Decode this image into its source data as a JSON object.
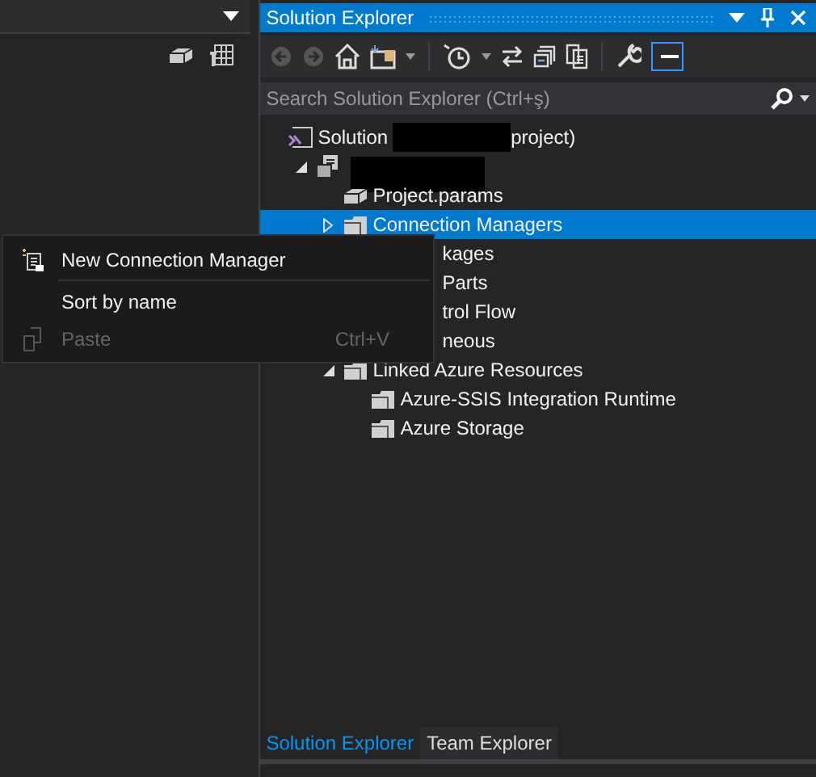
{
  "solution_explorer": {
    "title": "Solution Explorer",
    "search": {
      "placeholder": "Search Solution Explorer (Ctrl+ş)"
    },
    "tree": [
      {
        "kind": "solution",
        "label": "Solution",
        "redacted": true,
        "suffix": "project)",
        "children": [
          {
            "kind": "project",
            "redacted": true,
            "expanded": true,
            "children": [
              {
                "kind": "params",
                "label": "Project.params"
              },
              {
                "kind": "folder",
                "label": "Connection Managers",
                "expanded": false,
                "selected": true
              },
              {
                "kind": "partial",
                "label": "kages"
              },
              {
                "kind": "partial",
                "label": "Parts"
              },
              {
                "kind": "partial",
                "label": "trol Flow"
              },
              {
                "kind": "partial",
                "label": "neous"
              },
              {
                "kind": "folder",
                "label": "Linked Azure Resources",
                "expanded": true,
                "selected": false,
                "children": [
                  {
                    "kind": "folder",
                    "label": "Azure-SSIS Integration Runtime"
                  },
                  {
                    "kind": "folder",
                    "label": "Azure Storage"
                  }
                ]
              }
            ]
          }
        ]
      }
    ],
    "tabs": [
      {
        "label": "Solution Explorer",
        "selected": true
      },
      {
        "label": "Team Explorer",
        "selected": false
      }
    ]
  },
  "context_menu": [
    {
      "kind": "item",
      "label": "New Connection Manager",
      "disabled": false
    },
    {
      "kind": "separator"
    },
    {
      "kind": "item",
      "label": "Sort by name",
      "disabled": false
    },
    {
      "kind": "item",
      "label": "Paste",
      "shortcut": "Ctrl+V",
      "disabled": true
    }
  ]
}
